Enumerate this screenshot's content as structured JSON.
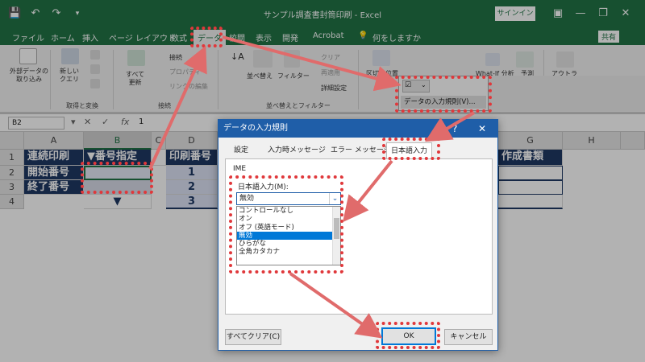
{
  "window": {
    "title": "サンプル調査書封筒印刷 - Excel",
    "signin": "サインイン"
  },
  "tabs": [
    {
      "label": "ファイル"
    },
    {
      "label": "ホーム"
    },
    {
      "label": "挿入"
    },
    {
      "label": "ページ レイアウト"
    },
    {
      "label": "数式"
    },
    {
      "label": "データ"
    },
    {
      "label": "校閲"
    },
    {
      "label": "表示"
    },
    {
      "label": "開発"
    },
    {
      "label": "Acrobat"
    },
    {
      "label": "何をしますか"
    }
  ],
  "share_label": "共有",
  "ribbon": {
    "external": "外部データの\n取り込み",
    "new_query": "新しい\nクエリ",
    "refresh_all": "すべて\n更新",
    "connections": "接続",
    "properties": "プロパティ",
    "edit_links": "リンクの編集",
    "sort": "並べ替え",
    "filter": "フィルター",
    "clear": "クリア",
    "reapply": "再適用",
    "advanced": "詳細設定",
    "text_to_columns": "区切り位置",
    "what_if": "What-If 分析",
    "forecast_sheet": "予測\nシート",
    "outline": "アウトラ\nイン",
    "group_get_transform": "取得と変換",
    "group_connections": "接続",
    "group_sort_filter": "並べ替えとフィルター",
    "group_forecast": "予測",
    "validation_menu": "データの入力規則(V)..."
  },
  "formula_bar": {
    "namebox": "B2",
    "fx": "fx",
    "value": "1"
  },
  "sheet": {
    "columns": [
      "A",
      "B",
      "C",
      "D",
      "G",
      "H"
    ],
    "rows": [
      "1",
      "2",
      "3",
      "4"
    ],
    "a1": "連続印刷",
    "b1": "▼番号指定",
    "d1": "印刷番号",
    "g1": "作成書類",
    "a2": "開始番号",
    "a3": "終了番号",
    "b4": "▼",
    "d2": "1",
    "d3": "2",
    "d4": "3"
  },
  "dialog": {
    "title": "データの入力規則",
    "help": "?",
    "close": "✕",
    "tabs": [
      "設定",
      "入力時メッセージ",
      "エラー メッセージ",
      "日本語入力"
    ],
    "active_tab": 3,
    "section": "IME",
    "field_label": "日本語入力(M):",
    "selected": "無効",
    "options": [
      "コントロールなし",
      "オン",
      "オフ (英語モード)",
      "無効",
      "ひらがな",
      "全角カタカナ"
    ],
    "selected_index": 3,
    "clear_all": "すべてクリア(C)",
    "ok": "OK",
    "cancel": "キャンセル"
  },
  "colors": {
    "excel_green": "#217346",
    "navy": "#1f3864",
    "highlight_red": "#e0383b",
    "arrow": "#e06b6b"
  }
}
